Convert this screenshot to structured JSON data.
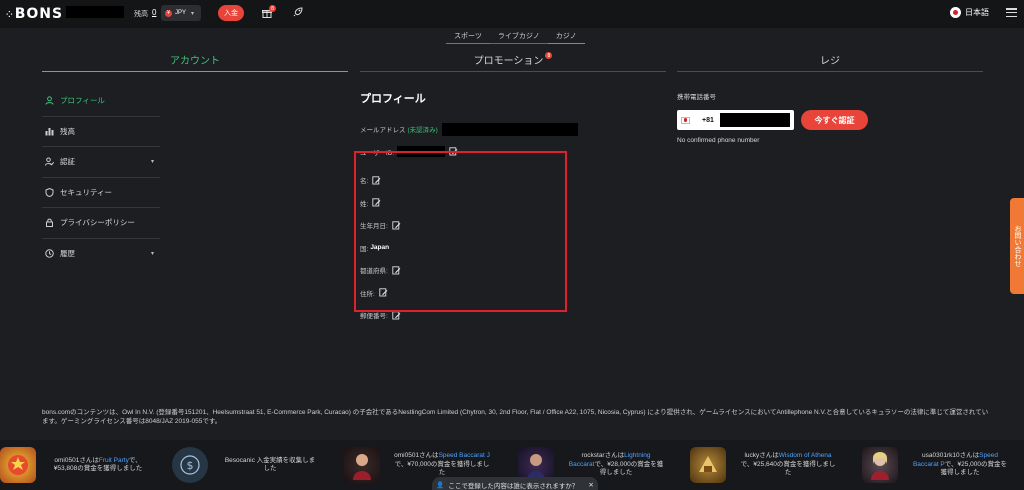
{
  "header": {
    "logo_text": "BONS",
    "balance_label": "残高",
    "balance_value": "0",
    "currency": "JPY",
    "currency_symbol": "¥",
    "deposit_label": "入金",
    "gift_badge": "8",
    "language": "日本語"
  },
  "subnav": [
    "スポーツ",
    "ライブカジノ",
    "カジノ"
  ],
  "tabs": {
    "account": "アカウント",
    "promotion": "プロモーション",
    "promotion_badge": "8",
    "cashier": "レジ"
  },
  "sidebar": {
    "items": [
      {
        "label": "プロフィール",
        "icon": "user-icon"
      },
      {
        "label": "残高",
        "icon": "balance-icon"
      },
      {
        "label": "認証",
        "icon": "verify-icon"
      },
      {
        "label": "セキュリティー",
        "icon": "shield-icon"
      },
      {
        "label": "プライバシーポリシー",
        "icon": "lock-icon"
      },
      {
        "label": "履歴",
        "icon": "history-icon"
      }
    ]
  },
  "profile": {
    "title": "プロフィール",
    "email_label": "メールアドレス",
    "email_status": "(未認済み)",
    "user_id_label": "ユーザーID:",
    "first_name_label": "名:",
    "last_name_label": "姓:",
    "birthdate_label": "生年月日:",
    "country_label": "国:",
    "country_value": "Japan",
    "prefecture_label": "都道府県:",
    "address_label": "住所:",
    "postal_label": "郵便番号:"
  },
  "phone": {
    "label": "携帯電話番号",
    "country_code": "+81",
    "verify_button": "今すぐ認証",
    "note": "No confirmed phone number"
  },
  "side_tab": "お問い合わせ",
  "footer": {
    "text": "bons.comのコンテンツは、Owl In N.V. (登録番号151201、Heelsumstraat 51, E-Commerce Park, Curacao) の子会社であるNestlingCom Limited (Chytron, 30, 2nd Floor, Flat / Office A22, 1075, Nicosia, Cyprus) により提供され、ゲームライセンスにおいてAntillephone N.V.と合意しているキュラソーの法律に準じて運営されています。ゲーミングライセンス番号は8048/JAZ 2019-055です。"
  },
  "ticker": [
    {
      "pre": "omi0501さんは",
      "game": "Fruit Party",
      "post": "で、¥53,808の賞金を獲得しました"
    },
    {
      "pre": "Besocanic 入金実績を収集しました",
      "game": "",
      "post": ""
    },
    {
      "pre": "omi0501さんは",
      "game": "Speed Baccarat J",
      "post": "で、¥70,000の賞金を獲得しました"
    },
    {
      "pre": "rockstarさんは",
      "game": "Lightning Baccarat",
      "post": "で、¥28,000の賞金を獲得しました"
    },
    {
      "pre": "luckyさんは",
      "game": "Wisdom of Athena",
      "post": "で、¥25,640の賞金を獲得しました"
    },
    {
      "pre": "usa0301rk10さんは",
      "game": "Speed Baccarat P",
      "post": "で、¥25,000の賞金を獲得しました"
    }
  ],
  "bottom_pill": "ここで登録した内容は誰に表示されますか？",
  "colors": {
    "accent_green": "#3cc57a",
    "accent_red": "#e8443a",
    "highlight_red": "#e0212b",
    "side_tab_orange": "#f07a35",
    "background": "#1c1e21"
  }
}
